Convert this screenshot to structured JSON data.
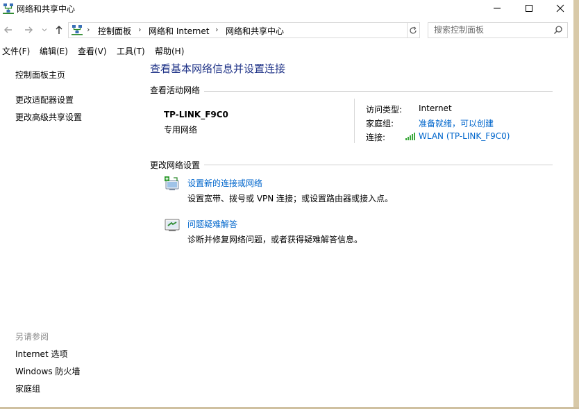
{
  "window": {
    "title": "网络和共享中心"
  },
  "address": {
    "breadcrumbs": [
      "控制面板",
      "网络和 Internet",
      "网络和共享中心"
    ],
    "search_placeholder": "搜索控制面板"
  },
  "menu": [
    "文件(F)",
    "编辑(E)",
    "查看(V)",
    "工具(T)",
    "帮助(H)"
  ],
  "sidebar": {
    "links": [
      "控制面板主页",
      "更改适配器设置",
      "更改高级共享设置"
    ],
    "see_also_title": "另请参阅",
    "see_also": [
      "Internet 选项",
      "Windows 防火墙",
      "家庭组"
    ]
  },
  "main": {
    "title": "查看基本网络信息并设置连接",
    "active_header": "查看活动网络",
    "network": {
      "name": "TP-LINK_F9C0",
      "type": "专用网络",
      "access_label": "访问类型:",
      "access_value": "Internet",
      "homegroup_label": "家庭组:",
      "homegroup_value": "准备就绪，可以创建",
      "connection_label": "连接:",
      "connection_value": "WLAN (TP-LINK_F9C0)"
    },
    "change_header": "更改网络设置",
    "tasks": [
      {
        "link": "设置新的连接或网络",
        "desc": "设置宽带、拨号或 VPN 连接；或设置路由器或接入点。"
      },
      {
        "link": "问题疑难解答",
        "desc": "诊断并修复网络问题，或者获得疑难解答信息。"
      }
    ]
  },
  "colors": {
    "title_blue": "#1e3287",
    "link_blue": "#0066cc",
    "muted": "#8a8a8a"
  }
}
